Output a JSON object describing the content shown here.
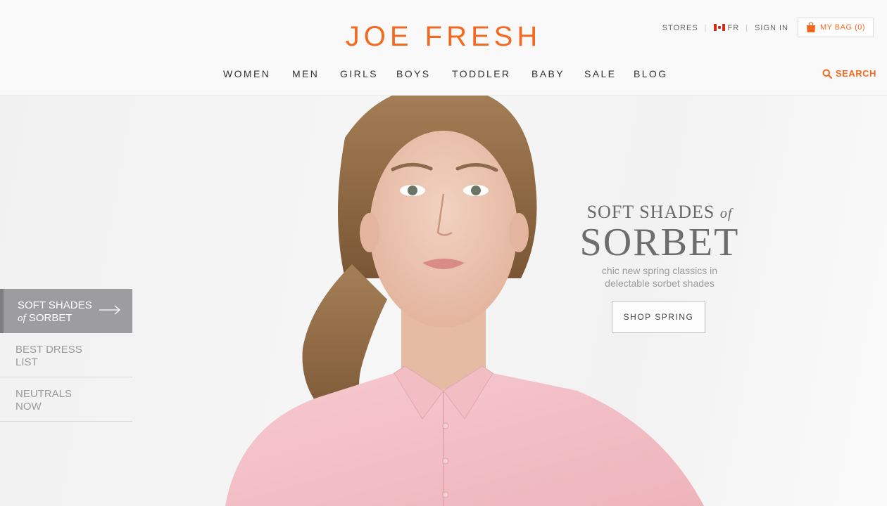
{
  "brand": {
    "logo": "JOE FRESH",
    "accent": "#f26a21"
  },
  "utility": {
    "stores": "STORES",
    "language": "FR",
    "sign_in": "SIGN IN",
    "bag_label": "MY BAG (0)"
  },
  "nav": {
    "items": [
      "WOMEN",
      "MEN",
      "GIRLS",
      "BOYS",
      "TODDLER",
      "BABY",
      "SALE",
      "BLOG"
    ],
    "search": "SEARCH"
  },
  "hero": {
    "line1": "SOFT SHADES",
    "line1_of": "of",
    "line2": "SORBET",
    "sub1": "chic new spring classics in",
    "sub2": "delectable sorbet shades",
    "cta": "SHOP SPRING"
  },
  "promos": [
    {
      "line1": "SOFT SHADES",
      "of": "of",
      "line2": "SORBET",
      "active": true
    },
    {
      "line1": "BEST DRESS",
      "line2": "LIST",
      "active": false
    },
    {
      "line1": "NEUTRALS",
      "line2": "NOW",
      "active": false
    }
  ],
  "icons": {
    "bag": "shopping-bag-icon",
    "search": "search-icon",
    "flag": "canada-flag-icon",
    "arrow": "arrow-right-icon"
  }
}
